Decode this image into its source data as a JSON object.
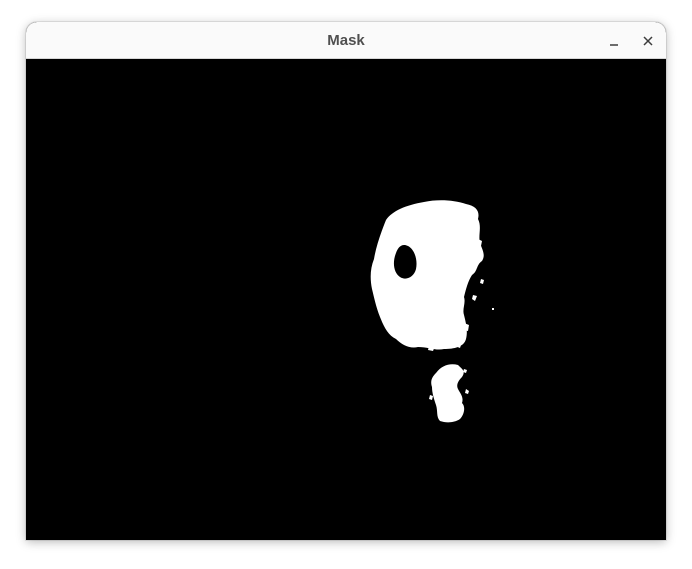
{
  "window": {
    "title": "Mask",
    "controls": {
      "minimize_icon": "minimize-icon",
      "close_icon": "close-icon"
    }
  },
  "mask_view": {
    "background_color": "#000000",
    "foreground_color": "#ffffff",
    "titlebar_color": "#fafafa",
    "title_color": "#505050"
  }
}
